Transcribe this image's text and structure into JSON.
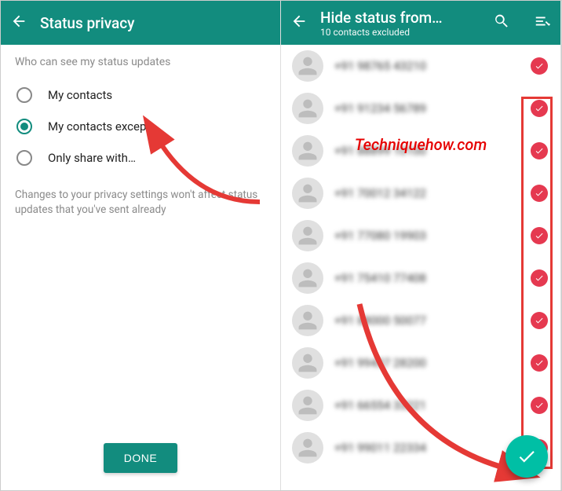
{
  "left": {
    "title": "Status privacy",
    "section_head": "Who can see my status updates",
    "options": [
      {
        "label": "My contacts",
        "selected": false
      },
      {
        "label": "My contacts except…",
        "selected": true
      },
      {
        "label": "Only share with…",
        "selected": false
      }
    ],
    "hint": "Changes to your privacy settings won't affect status updates that you've sent already",
    "done_label": "DONE"
  },
  "right": {
    "title": "Hide status from…",
    "subtitle": "10 contacts excluded",
    "contacts": [
      {
        "label": "+91 98765 43210",
        "checked": true
      },
      {
        "label": "+91 91234 56789",
        "checked": true
      },
      {
        "label": "+91 88899 10100",
        "checked": true
      },
      {
        "label": "+91 70012 34122",
        "checked": true
      },
      {
        "label": "+91 77080 19903",
        "checked": true
      },
      {
        "label": "+91 75410 77408",
        "checked": true
      },
      {
        "label": "+91 88000 50077",
        "checked": true
      },
      {
        "label": "+91 99437 28200",
        "checked": true
      },
      {
        "label": "+91 66554 33221",
        "checked": true
      },
      {
        "label": "+91 99011 22334",
        "checked": true
      }
    ]
  },
  "watermark": "Techniquehow.com",
  "colors": {
    "primary": "#128C7E",
    "fab": "#00bfa5",
    "check": "#e53950",
    "annotation": "#e53935"
  }
}
